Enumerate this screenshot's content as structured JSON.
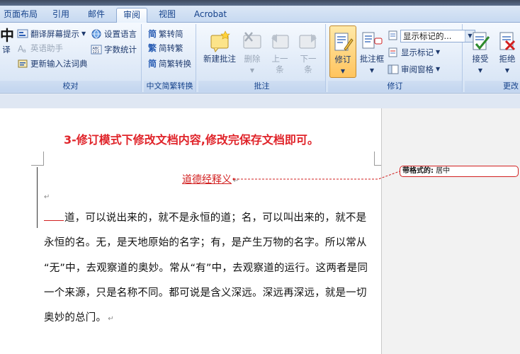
{
  "tabs": [
    {
      "label": "页面布局",
      "active": false
    },
    {
      "label": "引用",
      "active": false
    },
    {
      "label": "邮件",
      "active": false
    },
    {
      "label": "审阅",
      "active": true
    },
    {
      "label": "视图",
      "active": false
    },
    {
      "label": "Acrobat",
      "active": false
    }
  ],
  "ribbon": {
    "proofing": {
      "label": "校对",
      "big_char": "中",
      "big_label": "译",
      "translate_tip": "翻译屏幕提示",
      "english_helper": "英语助手",
      "update_ime": "更新输入法词典",
      "set_language": "设置语言",
      "word_count": "字数统计"
    },
    "chinese_conversion": {
      "label": "中文简繁转换",
      "to_traditional": "繁转简",
      "to_simplified": "简转繁",
      "conversion": "简繁转换"
    },
    "comments": {
      "label": "批注",
      "new_comment": "新建批注",
      "delete": "删除",
      "previous": "上一条",
      "previous_line1": "上一",
      "previous_line2": "条",
      "next_line1": "下一",
      "next_line2": "条"
    },
    "tracking": {
      "label": "修订",
      "track_changes": "修订",
      "balloons": "批注框",
      "display_combo": "显示标记的...",
      "show_markup": "显示标记",
      "review_pane": "审阅窗格"
    },
    "changes": {
      "label": "更改",
      "accept": "接受",
      "reject": "拒绝"
    }
  },
  "document": {
    "instruction": "3-修订模式下修改文档内容,修改完保存文档即可。",
    "title": "道德经释义",
    "lines": [
      "道，可以说出来的，就不是永恒的道；名，可以叫出来的，就不是",
      "永恒的名。无，是天地原始的名字；有，是产生万物的名字。所以常从",
      "“无”中，去观察道的奥妙。常从“有”中，去观察道的运行。这两者是同",
      "一个来源，只是名称不同。都可说是含义深远。深远再深远，就是一切",
      "奥妙的总门。"
    ],
    "paragraph_mark": "↵"
  },
  "balloon": {
    "label": "带格式的:",
    "value": "居中"
  },
  "colors": {
    "accent_red": "#e0242a",
    "ribbon_text": "#15428b"
  }
}
